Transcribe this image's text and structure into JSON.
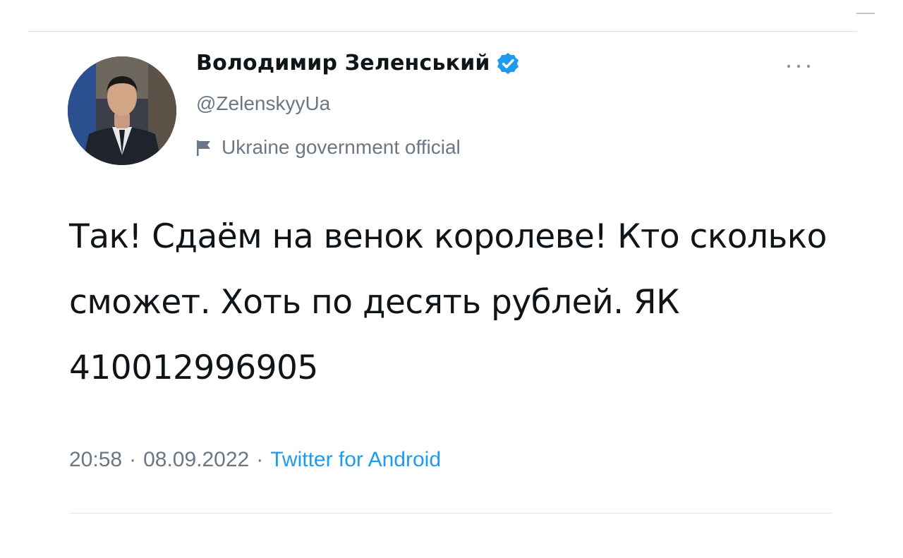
{
  "author": {
    "display_name": "Володимир Зеленський",
    "handle": "@ZelenskyyUa",
    "label": "Ukraine government official"
  },
  "tweet": {
    "text": "Так! Сдаём на венок королеве! Кто сколько сможет. Хоть по десять рублей. ЯК 410012996905",
    "time": "20:58",
    "separator": "·",
    "date": "08.09.2022",
    "source": "Twitter for Android"
  },
  "icons": {
    "verified": "verified-badge-icon",
    "label": "flag-icon",
    "more": "more-options-icon"
  },
  "colors": {
    "accent": "#1d9bf0",
    "text": "#0f1419",
    "secondary": "#6b7785"
  }
}
